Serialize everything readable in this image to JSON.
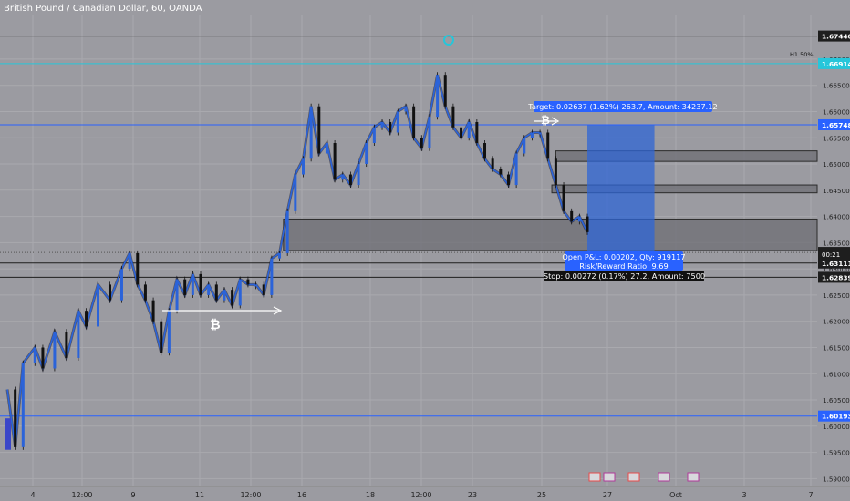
{
  "chart_data": {
    "type": "candlestick",
    "title": "British Pound / Canadian Dollar, 60, OANDA",
    "ylim": [
      1.5885,
      1.6785
    ],
    "y_ticks": [
      1.59,
      1.595,
      1.6,
      1.605,
      1.61,
      1.615,
      1.62,
      1.625,
      1.63,
      1.635,
      1.64,
      1.645,
      1.65,
      1.655,
      1.66,
      1.665,
      1.67
    ],
    "y_tick_labels": [
      "1.59000",
      "1.59500",
      "1.60000",
      "1.60500",
      "1.61000",
      "1.61500",
      "1.62000",
      "1.62500",
      "1.63000",
      "1.63500",
      "1.64000",
      "1.64500",
      "1.65000",
      "1.65500",
      "1.66000",
      "1.66500",
      "1.67000"
    ],
    "x_ticks": [
      "4",
      "12:00",
      "9",
      "11",
      "12:00",
      "16",
      "18",
      "12:00",
      "23",
      "25",
      "27",
      "Oct",
      "3",
      "7"
    ],
    "price_series": [
      [
        0,
        1.607
      ],
      [
        2,
        1.596
      ],
      [
        4,
        1.612
      ],
      [
        7,
        1.615
      ],
      [
        9,
        1.611
      ],
      [
        12,
        1.618
      ],
      [
        15,
        1.613
      ],
      [
        18,
        1.622
      ],
      [
        20,
        1.619
      ],
      [
        23,
        1.627
      ],
      [
        26,
        1.624
      ],
      [
        29,
        1.63
      ],
      [
        31,
        1.633
      ],
      [
        33,
        1.627
      ],
      [
        35,
        1.624
      ],
      [
        37,
        1.62
      ],
      [
        39,
        1.614
      ],
      [
        41,
        1.622
      ],
      [
        43,
        1.628
      ],
      [
        45,
        1.625
      ],
      [
        47,
        1.629
      ],
      [
        49,
        1.625
      ],
      [
        51,
        1.627
      ],
      [
        53,
        1.624
      ],
      [
        55,
        1.626
      ],
      [
        57,
        1.623
      ],
      [
        59,
        1.628
      ],
      [
        61,
        1.627
      ],
      [
        63,
        1.627
      ],
      [
        65,
        1.625
      ],
      [
        67,
        1.632
      ],
      [
        69,
        1.633
      ],
      [
        71,
        1.641
      ],
      [
        73,
        1.648
      ],
      [
        75,
        1.651
      ],
      [
        77,
        1.661
      ],
      [
        79,
        1.652
      ],
      [
        81,
        1.654
      ],
      [
        83,
        1.647
      ],
      [
        85,
        1.648
      ],
      [
        87,
        1.646
      ],
      [
        89,
        1.65
      ],
      [
        91,
        1.654
      ],
      [
        93,
        1.657
      ],
      [
        95,
        1.658
      ],
      [
        97,
        1.656
      ],
      [
        99,
        1.66
      ],
      [
        101,
        1.661
      ],
      [
        103,
        1.655
      ],
      [
        105,
        1.653
      ],
      [
        107,
        1.659
      ],
      [
        109,
        1.667
      ],
      [
        111,
        1.661
      ],
      [
        113,
        1.657
      ],
      [
        115,
        1.655
      ],
      [
        117,
        1.658
      ],
      [
        119,
        1.654
      ],
      [
        121,
        1.651
      ],
      [
        123,
        1.649
      ],
      [
        125,
        1.648
      ],
      [
        127,
        1.646
      ],
      [
        129,
        1.652
      ],
      [
        131,
        1.655
      ],
      [
        133,
        1.656
      ],
      [
        135,
        1.656
      ],
      [
        137,
        1.651
      ],
      [
        139,
        1.646
      ],
      [
        141,
        1.641
      ],
      [
        143,
        1.639
      ],
      [
        145,
        1.64
      ],
      [
        147,
        1.637
      ]
    ],
    "candle_x_range": [
      0,
      147
    ],
    "h_lines": [
      {
        "value": 1.6744,
        "label": "1.67440",
        "color": "#1e1e1e"
      },
      {
        "value": 1.66914,
        "label": "1.66914",
        "color": "#26c6da"
      },
      {
        "value": 1.65748,
        "label": "1.65748",
        "color": "#2962ff"
      },
      {
        "value": 1.63314,
        "label": "1.63314",
        "color": "#555555",
        "dotted": true
      },
      {
        "value": 1.63111,
        "label": "1.63111",
        "color": "#1e1e1e"
      },
      {
        "value": 1.62839,
        "label": "1.62839",
        "color": "#1e1e1e"
      },
      {
        "value": 1.60193,
        "label": "1.60193",
        "color": "#2962ff"
      }
    ],
    "countdown": "00:21",
    "h1_label": "H1 50%",
    "zones": [
      {
        "y_top": 1.6395,
        "y_bottom": 1.6335,
        "x_from": 70
      },
      {
        "y_top": 1.6525,
        "y_bottom": 1.6505,
        "x_from": 139
      },
      {
        "y_top": 1.646,
        "y_bottom": 1.6445,
        "x_from": 138
      }
    ],
    "position": {
      "target_label": "Target: 0.02637 (1.62%) 263.7, Amount: 34237.12",
      "pnl_label": "Open P&L: 0.00202, Qty: 919117",
      "rr_label": "Risk/Reward Ratio: 9.69",
      "stop_label": "Stop: 0.00272 (0.17%) 27.2, Amount: 7500",
      "top": 1.6575,
      "bottom": 1.6334,
      "x_from": 147,
      "x_to": 164
    },
    "bitcoin_symbol": "₿"
  }
}
